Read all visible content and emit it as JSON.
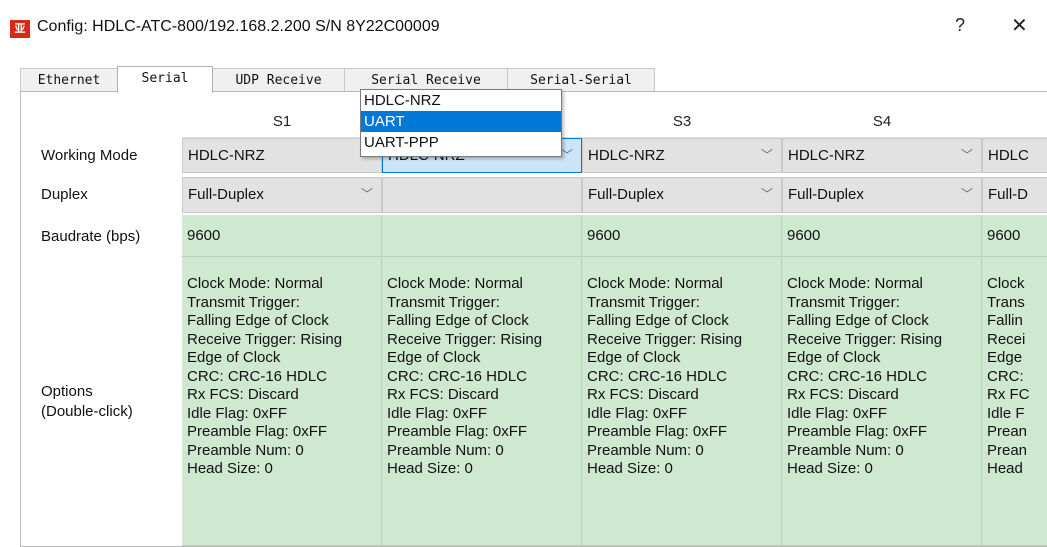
{
  "window": {
    "title": "Config: HDLC-ATC-800/192.168.2.200  S/N 8Y22C00009",
    "app_icon_text": "亚",
    "help": "?",
    "close": "✕"
  },
  "tabs": [
    {
      "label": "Ethernet",
      "active": false
    },
    {
      "label": "Serial",
      "active": true
    },
    {
      "label": "UDP Receive",
      "active": false
    },
    {
      "label": "Serial Receive",
      "active": false
    },
    {
      "label": "Serial-Serial",
      "active": false
    }
  ],
  "grid": {
    "columns": [
      "S1",
      "S2",
      "S3",
      "S4",
      ""
    ],
    "row_labels": {
      "working_mode": "Working Mode",
      "duplex": "Duplex",
      "baudrate": "Baudrate (bps)",
      "options": "Options\n(Double-click)"
    },
    "working_mode": [
      "HDLC-NRZ",
      "HDLC-NRZ",
      "HDLC-NRZ",
      "HDLC-NRZ",
      "HDLC"
    ],
    "duplex": [
      "Full-Duplex",
      "",
      "Full-Duplex",
      "Full-Duplex",
      "Full-D"
    ],
    "baudrate": [
      "9600",
      "",
      "9600",
      "9600",
      "9600"
    ],
    "options_lines": [
      "Clock Mode: Normal",
      "Transmit Trigger:",
      "Falling Edge of Clock",
      "Receive Trigger: Rising",
      "Edge of Clock",
      "CRC: CRC-16 HDLC",
      "Rx FCS: Discard",
      "Idle Flag: 0xFF",
      "Preamble Flag: 0xFF",
      "Preamble Num: 0",
      "Head Size: 0"
    ],
    "options_col5_lines": [
      "Clock",
      "Trans",
      "Fallin",
      "Recei",
      "Edge",
      "CRC:",
      "Rx FC",
      "Idle F",
      "Prean",
      "Prean",
      "Head"
    ]
  },
  "dropdown": {
    "options": [
      "HDLC-NRZ",
      "UART",
      "UART-PPP"
    ],
    "selected_index": 1
  },
  "colors": {
    "cell_bg": "#cfe9d0",
    "combo_bg": "#e2e2e2",
    "focus_bg": "#cce4f7",
    "selection": "#0078d7",
    "icon_red": "#d42a1c"
  }
}
